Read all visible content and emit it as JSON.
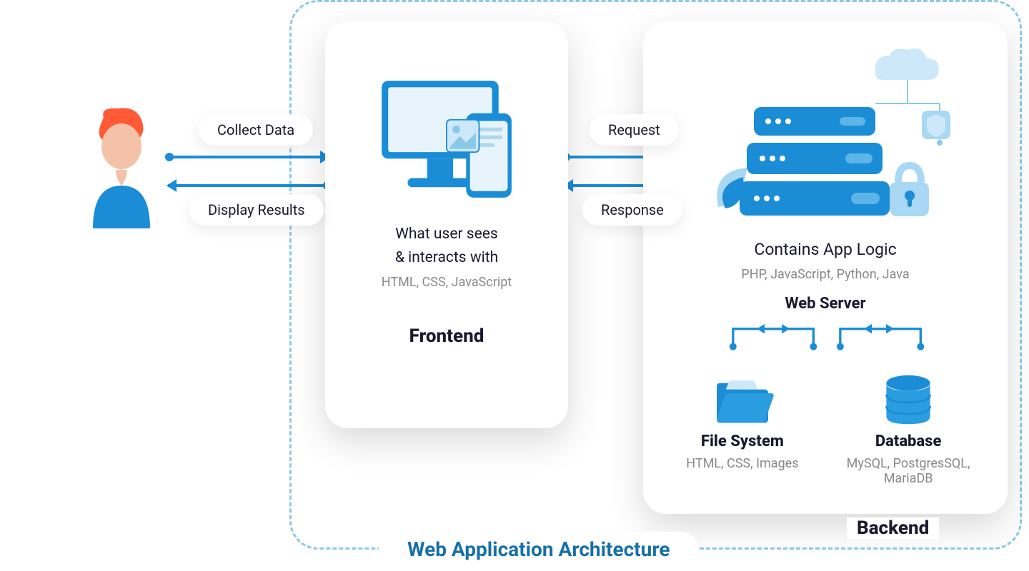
{
  "title": "Web Application Architecture",
  "user_to_frontend": {
    "top_label": "Collect Data",
    "bottom_label": "Display Results"
  },
  "frontend_to_backend": {
    "top_label": "Request",
    "bottom_label": "Response"
  },
  "frontend": {
    "label": "Frontend",
    "desc_line1": "What user sees",
    "desc_line2": "& interacts  with",
    "tech": "HTML, CSS, JavaScript"
  },
  "backend": {
    "label": "Backend",
    "desc": "Contains App Logic",
    "tech": "PHP, JavaScript, Python, Java",
    "web_server": "Web Server",
    "file_system": {
      "label": "File System",
      "tech": "HTML, CSS, Images"
    },
    "database": {
      "label": "Database",
      "tech": "MySQL, PostgresSQL, MariaDB"
    }
  }
}
